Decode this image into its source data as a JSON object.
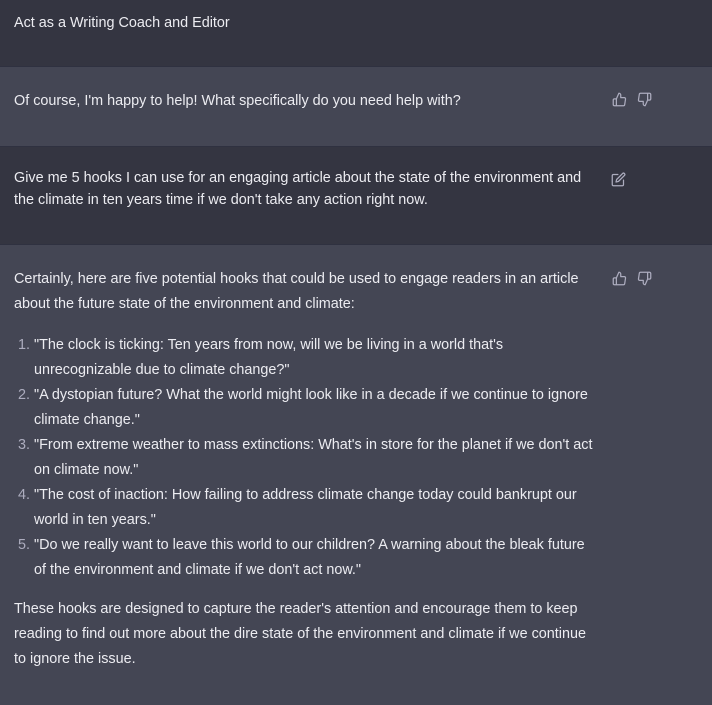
{
  "messages": [
    {
      "role": "user",
      "text": "Act as a Writing Coach and Editor"
    },
    {
      "role": "assistant",
      "text": "Of course, I'm happy to help! What specifically do you need help with?"
    },
    {
      "role": "user",
      "text": "Give me 5 hooks I can use for an engaging article about the state of the environment and the climate in ten years time if we don't take any action right now."
    },
    {
      "role": "assistant",
      "intro": "Certainly, here are five potential hooks that could be used to engage readers in an article about the future state of the environment and climate:",
      "hooks": [
        "\"The clock is ticking: Ten years from now, will we be living in a world that's unrecognizable due to climate change?\"",
        "\"A dystopian future? What the world might look like in a decade if we continue to ignore climate change.\"",
        "\"From extreme weather to mass extinctions: What's in store for the planet if we don't act on climate now.\"",
        "\"The cost of inaction: How failing to address climate change today could bankrupt our world in ten years.\"",
        "\"Do we really want to leave this world to our children? A warning about the bleak future of the environment and climate if we don't act now.\""
      ],
      "outro": "These hooks are designed to capture the reader's attention and encourage them to keep reading to find out more about the dire state of the environment and climate if we continue to ignore the issue."
    }
  ],
  "icons": {
    "thumbs_up": "thumbs-up-icon",
    "thumbs_down": "thumbs-down-icon",
    "edit": "edit-icon"
  },
  "colors": {
    "user_bg": "#343541",
    "assistant_bg": "#444654",
    "text": "#ececf1",
    "icon": "#acacbe"
  }
}
